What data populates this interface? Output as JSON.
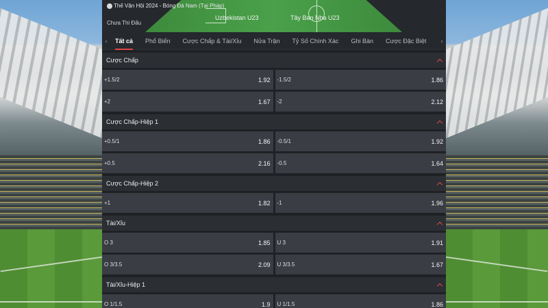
{
  "match": {
    "competition": "Thế Vận Hội 2024 - Bóng Đá Nam (Tại Pháp)",
    "status": "Chưa Thi Đấu",
    "home_team": "Uzbekistan U23",
    "away_team": "Tây Ban Nha U23"
  },
  "tabs": [
    {
      "label": "Tất cả",
      "active": true
    },
    {
      "label": "Phổ Biến"
    },
    {
      "label": "Cược Chấp & Tài/Xỉu"
    },
    {
      "label": "Nửa Trận"
    },
    {
      "label": "Tỷ Số Chính Xác"
    },
    {
      "label": "Ghi Bàn"
    },
    {
      "label": "Cược Đặc Biệt"
    }
  ],
  "icons": {
    "tab_left": "chevron-left-icon",
    "tab_right": "chevron-right-icon",
    "collapse": "chevron-up-icon"
  },
  "colors": {
    "accent": "#e04747",
    "panel": "#1f2125",
    "cell": "#3a3d43"
  },
  "sections": [
    {
      "title": "Cược Chấp",
      "rows": [
        [
          {
            "label": "+1.5/2",
            "odd": "1.92"
          },
          {
            "label": "-1.5/2",
            "odd": "1.86"
          }
        ],
        [
          {
            "label": "+2",
            "odd": "1.67"
          },
          {
            "label": "-2",
            "odd": "2.12"
          }
        ]
      ]
    },
    {
      "title": "Cược Chấp-Hiệp 1",
      "rows": [
        [
          {
            "label": "+0.5/1",
            "odd": "1.86"
          },
          {
            "label": "-0.5/1",
            "odd": "1.92"
          }
        ],
        [
          {
            "label": "+0.5",
            "odd": "2.16"
          },
          {
            "label": "-0.5",
            "odd": "1.64"
          }
        ]
      ]
    },
    {
      "title": "Cược Chấp-Hiệp 2",
      "rows": [
        [
          {
            "label": "+1",
            "odd": "1.82"
          },
          {
            "label": "-1",
            "odd": "1.96"
          }
        ]
      ]
    },
    {
      "title": "Tài/Xỉu",
      "rows": [
        [
          {
            "label": "O 3",
            "odd": "1.85"
          },
          {
            "label": "U 3",
            "odd": "1.91"
          }
        ],
        [
          {
            "label": "O 3/3.5",
            "odd": "2.09"
          },
          {
            "label": "U 3/3.5",
            "odd": "1.67"
          }
        ]
      ]
    },
    {
      "title": "Tài/Xỉu-Hiệp 1",
      "rows": [
        [
          {
            "label": "O 1/1.5",
            "odd": "1.9"
          },
          {
            "label": "U 1/1.5",
            "odd": "1.86"
          }
        ]
      ]
    }
  ]
}
